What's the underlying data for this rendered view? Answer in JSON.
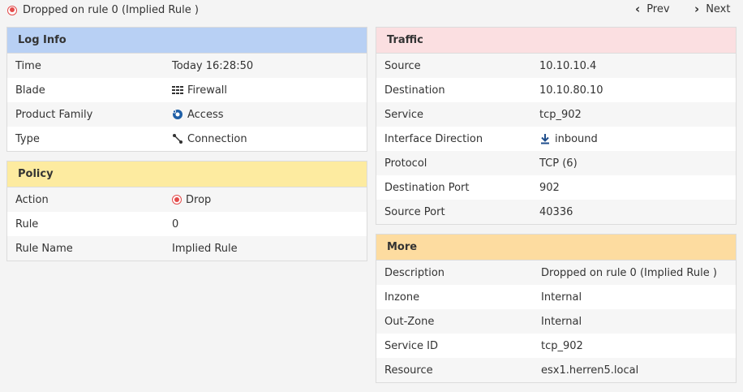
{
  "header": {
    "title": "Dropped on rule 0 (Implied Rule )",
    "prev_label": "Prev",
    "next_label": "Next"
  },
  "colors": {
    "log_info_header": "#b8d0f4",
    "policy_header": "#fdeba0",
    "traffic_header": "#fbdfe1",
    "more_header": "#fddca0",
    "drop_red": "#e34b4b",
    "access_blue": "#1f5fa6"
  },
  "log_info": {
    "title": "Log Info",
    "rows": [
      {
        "label": "Time",
        "value": "Today 16:28:50"
      },
      {
        "label": "Blade",
        "value": "Firewall",
        "icon": "firewall-icon"
      },
      {
        "label": "Product Family",
        "value": "Access",
        "icon": "access-icon"
      },
      {
        "label": "Type",
        "value": "Connection",
        "icon": "connection-icon"
      }
    ]
  },
  "policy": {
    "title": "Policy",
    "rows": [
      {
        "label": "Action",
        "value": "Drop",
        "icon": "drop-icon"
      },
      {
        "label": "Rule",
        "value": "0"
      },
      {
        "label": "Rule Name",
        "value": "Implied Rule"
      }
    ]
  },
  "traffic": {
    "title": "Traffic",
    "rows": [
      {
        "label": "Source",
        "value": "10.10.10.4"
      },
      {
        "label": "Destination",
        "value": "10.10.80.10"
      },
      {
        "label": "Service",
        "value": "tcp_902"
      },
      {
        "label": "Interface Direction",
        "value": "inbound",
        "icon": "arrow-down-icon"
      },
      {
        "label": "Protocol",
        "value": "TCP (6)"
      },
      {
        "label": "Destination Port",
        "value": "902"
      },
      {
        "label": "Source Port",
        "value": "40336"
      }
    ]
  },
  "more": {
    "title": "More",
    "rows": [
      {
        "label": "Description",
        "value": "Dropped on rule 0 (Implied Rule )"
      },
      {
        "label": "Inzone",
        "value": "Internal"
      },
      {
        "label": "Out-Zone",
        "value": "Internal"
      },
      {
        "label": "Service ID",
        "value": "tcp_902"
      },
      {
        "label": "Resource",
        "value": "esx1.herren5.local"
      }
    ]
  }
}
